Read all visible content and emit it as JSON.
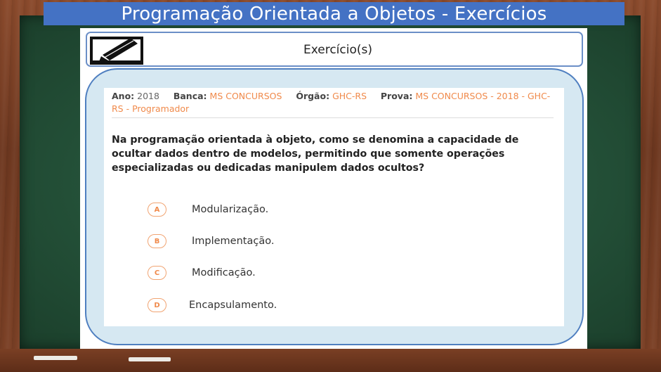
{
  "title": "Programação Orientada a Objetos - Exercícios",
  "header": {
    "label": "Exercício(s)",
    "icon": "pencil-note-icon"
  },
  "meta": {
    "ano_label": "Ano:",
    "ano_value": "2018",
    "banca_label": "Banca:",
    "banca_value": "MS CONCURSOS",
    "orgao_label": "Órgão:",
    "orgao_value": "GHC-RS",
    "prova_label": "Prova:",
    "prova_value": "MS CONCURSOS - 2018 - GHC-RS - Programador"
  },
  "question": "Na programação orientada à objeto, como se denomina a capacidade de ocultar dados dentro de modelos, permitindo que somente operações especializadas ou dedicadas manipulem dados ocultos?",
  "options": [
    {
      "letter": "A",
      "text": "Modularização."
    },
    {
      "letter": "B",
      "text": "Implementação."
    },
    {
      "letter": "C",
      "text": "Modificação."
    },
    {
      "letter": "D",
      "text": "Encapsulamento."
    }
  ],
  "colors": {
    "title_bar": "#4472c4",
    "board": "#234f37",
    "frame": "#6e3820",
    "accent": "#f08a4b",
    "content_bg": "#d6e8f2"
  }
}
